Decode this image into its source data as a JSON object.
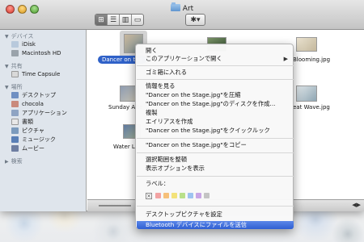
{
  "window": {
    "title": "Art"
  },
  "toolbar": {
    "view_icons": [
      "⊞",
      "☰",
      "▥",
      "▭"
    ],
    "action_icon": "✱▾"
  },
  "sidebar": {
    "devices_header": "デバイス",
    "devices": [
      "iDisk",
      "Macintosh HD"
    ],
    "shared_header": "共有",
    "shared": [
      "Time Capsule"
    ],
    "places_header": "場所",
    "places": [
      "デスクトップ",
      "chocola",
      "アプリケーション",
      "書類",
      "ピクチャ",
      "ミュージック",
      "ムービー"
    ],
    "search_header": "検索"
  },
  "content": {
    "selected_file": "Dancer on the",
    "right_file": "Blooming.jpg",
    "row2_left": "Sunday Afte",
    "row2_right": "eat Wave.jpg",
    "row3_left": "Water Li"
  },
  "menu": {
    "open": "開く",
    "open_with": "このアプリケーションで開く",
    "trash": "ゴミ箱に入れる",
    "get_info": "情報を見る",
    "compress": "\"Dancer on the Stage.jpg\"を圧縮",
    "burn": "\"Dancer on the Stage.jpg\"のディスクを作成...",
    "duplicate": "複製",
    "alias": "エイリアスを作成",
    "quicklook": "\"Dancer on the Stage.jpg\"をクイックルック",
    "copy": "\"Dancer on the Stage.jpg\"をコピー",
    "clean_up": "選択範囲を整頓",
    "view_options": "表示オプションを表示",
    "label": "ラベル：",
    "label_none": "×",
    "set_desktop": "デスクトップピクチャを設定",
    "bluetooth": "Bluetooth デバイスにファイルを送信"
  },
  "label_colors": [
    "#f2a3a3",
    "#f6c07a",
    "#f3e27a",
    "#b9e08a",
    "#9ec3f0",
    "#c9a6e6",
    "#c4c4c4"
  ]
}
